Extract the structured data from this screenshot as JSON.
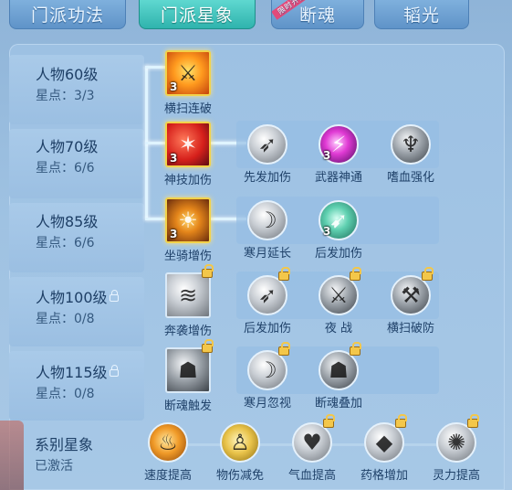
{
  "tabs": [
    {
      "label": "门派功法",
      "active": false
    },
    {
      "label": "门派星象",
      "active": true
    },
    {
      "label": "断魂",
      "active": false,
      "badge": "限时开放"
    },
    {
      "label": "韬光",
      "active": false
    }
  ],
  "rows": [
    {
      "level": "人物60级",
      "stars": "星点：3/3",
      "locked": false
    },
    {
      "level": "人物70级",
      "stars": "星点：6/6",
      "locked": false
    },
    {
      "level": "人物85级",
      "stars": "星点：6/6",
      "locked": false
    },
    {
      "level": "人物100级",
      "stars": "星点：0/8",
      "locked": true
    },
    {
      "level": "人物115级",
      "stars": "星点：0/8",
      "locked": true
    }
  ],
  "skills": {
    "r1_main": {
      "name": "横扫连破",
      "level": "3",
      "icon": "sweeping-strike-icon"
    },
    "r2_main": {
      "name": "神技加伤",
      "level": "3",
      "icon": "divine-skill-icon"
    },
    "r2_s1": {
      "name": "先发加伤",
      "icon": "first-strike-icon"
    },
    "r2_s2": {
      "name": "武器神通",
      "level": "3",
      "icon": "weapon-mastery-icon"
    },
    "r2_s3": {
      "name": "嗜血强化",
      "icon": "bloodthirst-icon"
    },
    "r3_main": {
      "name": "坐骑增伤",
      "level": "3",
      "icon": "mount-damage-icon"
    },
    "r3_s1": {
      "name": "寒月延长",
      "icon": "cold-moon-icon"
    },
    "r3_s2": {
      "name": "后发加伤",
      "level": "3",
      "icon": "counter-strike-icon"
    },
    "r4_main": {
      "name": "奔袭增伤",
      "icon": "charge-icon"
    },
    "r4_s1": {
      "name": "后发加伤",
      "icon": "counter-strike-icon"
    },
    "r4_s2": {
      "name": "夜 战",
      "icon": "night-battle-icon"
    },
    "r4_s3": {
      "name": "横扫破防",
      "icon": "sweep-break-icon"
    },
    "r5_main": {
      "name": "断魂触发",
      "icon": "soul-break-icon"
    },
    "r5_s1": {
      "name": "寒月忽视",
      "icon": "cold-moon-ignore-icon"
    },
    "r5_s2": {
      "name": "断魂叠加",
      "icon": "soul-stack-icon"
    }
  },
  "bottom": {
    "title": "系别星象",
    "status": "已激活",
    "items": [
      {
        "name": "速度提高",
        "icon": "speed-icon"
      },
      {
        "name": "物伤减免",
        "icon": "damage-reduce-icon"
      },
      {
        "name": "气血提高",
        "icon": "hp-icon"
      },
      {
        "name": "药格增加",
        "icon": "potion-slot-icon"
      },
      {
        "name": "灵力提高",
        "icon": "spirit-icon"
      }
    ]
  }
}
